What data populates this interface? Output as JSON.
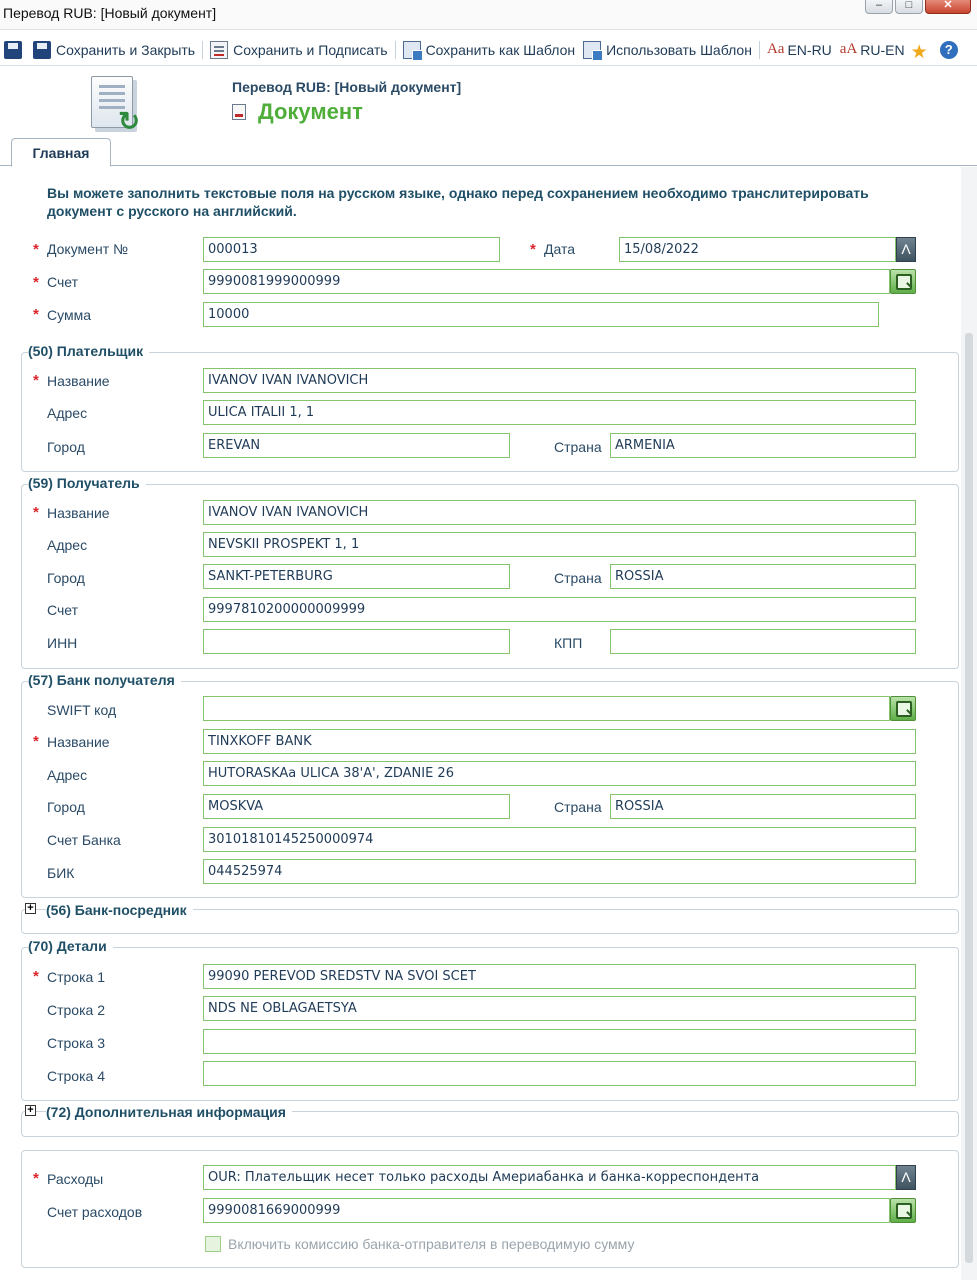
{
  "window": {
    "title": "Перевод RUB: [Новый документ]"
  },
  "toolbar": {
    "save_close": "Сохранить и Закрыть",
    "save_sign": "Сохранить и Подписать",
    "save_template": "Сохранить как Шаблон",
    "use_template": "Использовать Шаблон",
    "en_ru": "EN-RU",
    "ru_en": "RU-EN",
    "aa_icon_1": "Aa",
    "aa_icon_2": "aA",
    "help_icon": "?"
  },
  "header": {
    "subtitle": "Перевод RUB: [Новый документ]",
    "title": "Документ"
  },
  "tabs": [
    {
      "label": "Главная"
    }
  ],
  "note": "Вы можете заполнить текстовые поля на русском языке, однако перед сохранением необходимо транслитерировать документ с русского на английский.",
  "main": {
    "doc_no_label": "Документ №",
    "doc_no": "000013",
    "date_label": "Дата",
    "date": "15/08/2022",
    "account_label": "Счет",
    "account": "9990081999000999",
    "amount_label": "Сумма",
    "amount": "10000"
  },
  "payer": {
    "legend": "(50) Плательщик",
    "name_label": "Название",
    "name": "IVANOV IVAN IVANOVICH",
    "address_label": "Адрес",
    "address": "ULICA ITALII 1, 1",
    "city_label": "Город",
    "city": "EREVAN",
    "country_label": "Страна",
    "country": "ARMENIA"
  },
  "beneficiary": {
    "legend": "(59) Получатель",
    "name_label": "Название",
    "name": "IVANOV IVAN IVANOVICH",
    "address_label": "Адрес",
    "address": "NEVSKII PROSPEKT 1, 1",
    "city_label": "Город",
    "city": "SANKT-PETERBURG",
    "country_label": "Страна",
    "country": "ROSSIA",
    "account_label": "Счет",
    "account": "9997810200000009999",
    "inn_label": "ИНН",
    "inn": "",
    "kpp_label": "КПП",
    "kpp": ""
  },
  "bank": {
    "legend": "(57) Банк получателя",
    "swift_label": "SWIFT код",
    "swift": "",
    "name_label": "Название",
    "name": "TINXKOFF BANK",
    "address_label": "Адрес",
    "address": "HUTORASKAa ULICA 38'A', ZDANIE 26",
    "city_label": "Город",
    "city": "MOSKVA",
    "country_label": "Страна",
    "country": "ROSSIA",
    "account_label": "Счет Банка",
    "account": "30101810145250000974",
    "bik_label": "БИК",
    "bik": "044525974"
  },
  "intermediary": {
    "legend": "(56) Банк-посредник",
    "expand_glyph": "+"
  },
  "details": {
    "legend": "(70) Детали",
    "line1_label": "Строка 1",
    "line1": "99090 PEREVOD SREDSTV NA SVOI SCET",
    "line2_label": "Строка 2",
    "line2": "NDS NE OBLAGAETSYA",
    "line3_label": "Строка 3",
    "line3": "",
    "line4_label": "Строка 4",
    "line4": ""
  },
  "additional": {
    "legend": "(72) Дополнительная информация",
    "expand_glyph": "+"
  },
  "charges": {
    "label": "Расходы",
    "value": "OUR: Плательщик несет только расходы Америабанка и банка-корреспондента",
    "account_label": "Счет расходов",
    "account": "9990081669000999",
    "include_fee_label": "Включить комиссию банка-отправителя в переводимую сумму"
  },
  "required_mark": "*",
  "dropdown_glyph": "Λ",
  "colors": {
    "accent_green": "#4fae3a",
    "field_border": "#83c46c",
    "required": "#d9262d"
  }
}
